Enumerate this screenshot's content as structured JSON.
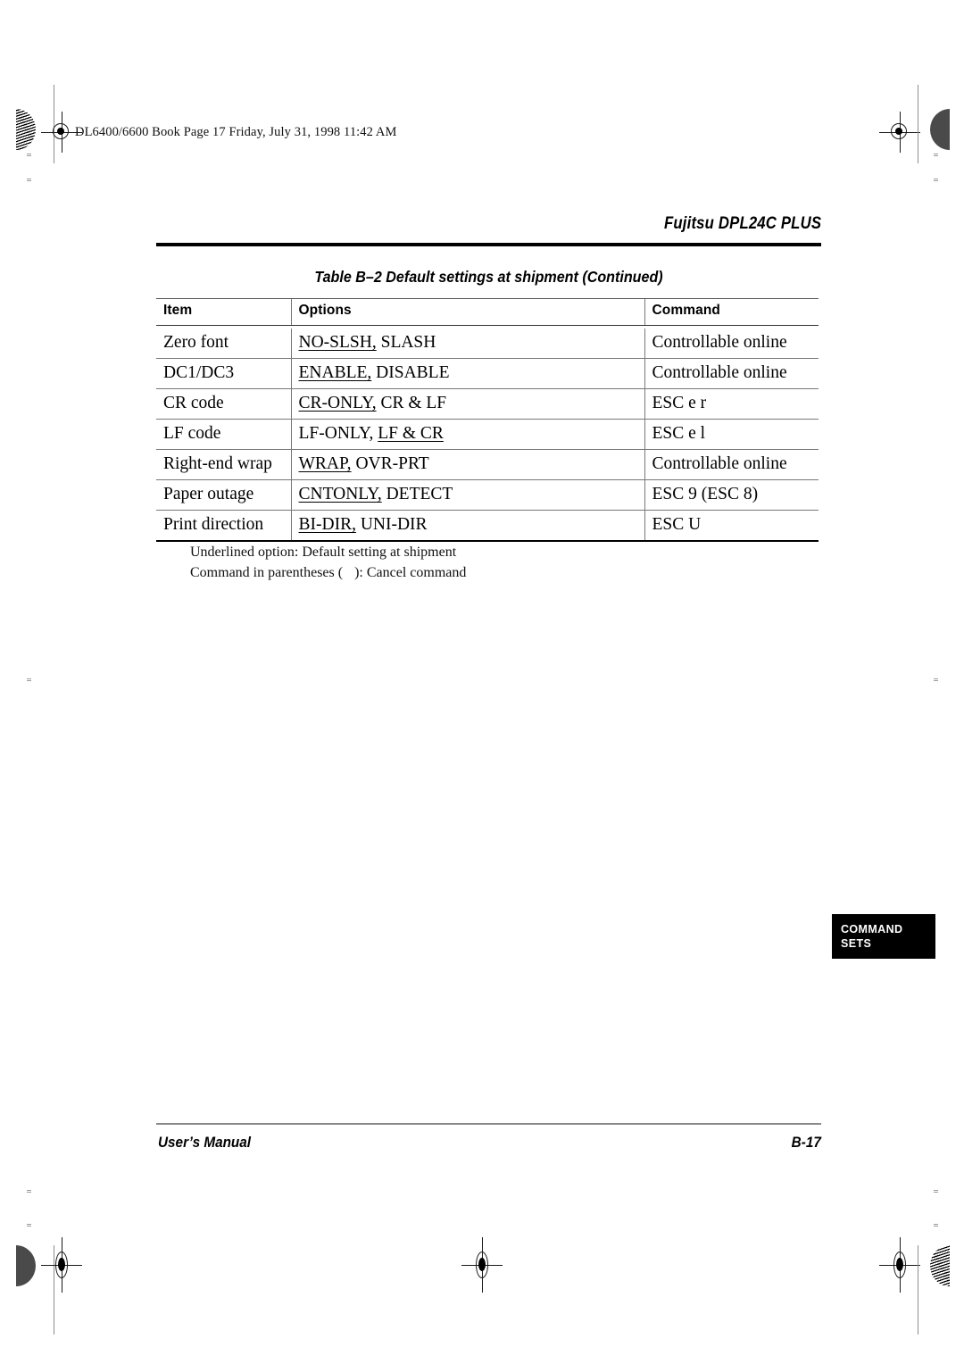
{
  "file_header": "DL6400/6600 Book  Page 17  Friday, July 31, 1998  11:42 AM",
  "running_head": "Fujitsu DPL24C PLUS",
  "table": {
    "caption": "Table B–2    Default settings at shipment (Continued)",
    "columns": [
      "Item",
      "Options",
      "Command"
    ],
    "rows": [
      {
        "item": "Zero font",
        "option_default": "NO-SLSH,",
        "option_rest": " SLASH",
        "default_first": true,
        "command": "Controllable online"
      },
      {
        "item": "DC1/DC3",
        "option_default": "ENABLE,",
        "option_rest": " DISABLE",
        "default_first": true,
        "command": "Controllable online"
      },
      {
        "item": "CR code",
        "option_default": "CR-ONLY,",
        "option_rest": " CR & LF",
        "default_first": true,
        "command": "ESC e r"
      },
      {
        "item": "LF code",
        "option_lead": "LF-ONLY, ",
        "option_default": "LF & CR",
        "default_first": false,
        "command": "ESC e l"
      },
      {
        "item": "Right-end wrap",
        "option_default": "WRAP,",
        "option_rest": " OVR-PRT",
        "default_first": true,
        "command": "Controllable online"
      },
      {
        "item": "Paper outage",
        "option_default": "CNTONLY,",
        "option_rest": " DETECT",
        "default_first": true,
        "command": "ESC 9 (ESC 8)"
      },
      {
        "item": "Print direction",
        "option_default": "BI-DIR,",
        "option_rest": " UNI-DIR",
        "default_first": true,
        "command": "ESC U"
      }
    ]
  },
  "footnotes": {
    "line1": "Underlined option: Default setting at shipment",
    "line2_before": "Command in parentheses (",
    "line2_after": "): Cancel command"
  },
  "thumb_tab": {
    "line1": "COMMAND",
    "line2": "SETS"
  },
  "footer": {
    "left": "User’s Manual",
    "right": "B-17"
  }
}
